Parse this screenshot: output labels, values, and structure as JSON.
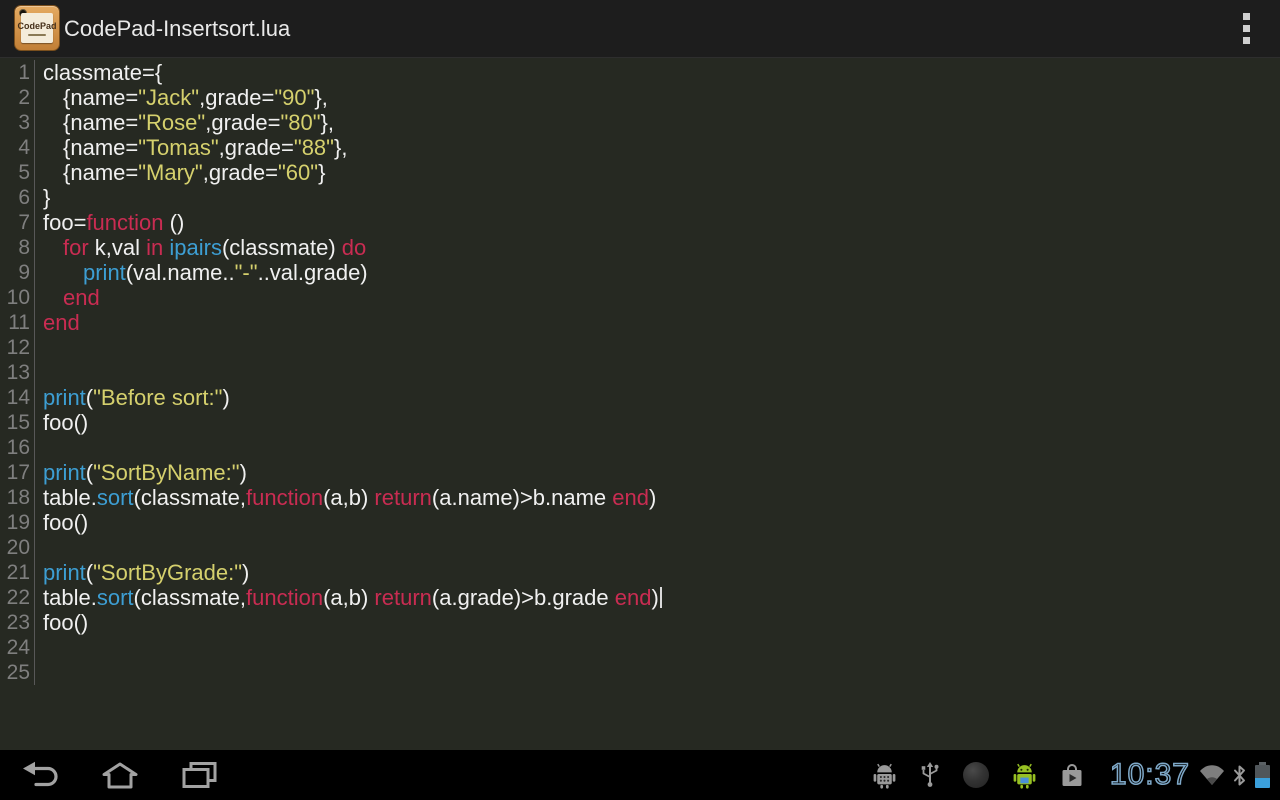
{
  "window": {
    "title": "CodePad-Insertsort.lua"
  },
  "titlebar": {
    "app_icon_label": "CodePad",
    "overflow_icon": "overflow-menu-icon"
  },
  "editor": {
    "colors": {
      "background": "#262922",
      "keyword": "#c92c52",
      "builtin": "#3d9ed3",
      "string": "#d5d06d",
      "text": "#f0f0f0",
      "line_number": "#7f7f7f"
    },
    "cursor": {
      "line": 22,
      "position": "end-of-line"
    },
    "lines": [
      {
        "n": "1",
        "segs": [
          [
            "classmate={",
            "p"
          ]
        ]
      },
      {
        "n": "2",
        "segs": [
          [
            "\t{name=",
            "p"
          ],
          [
            "\"Jack\"",
            "s"
          ],
          [
            ",grade=",
            "p"
          ],
          [
            "\"90\"",
            "s"
          ],
          [
            "},",
            "p"
          ]
        ]
      },
      {
        "n": "3",
        "segs": [
          [
            "\t{name=",
            "p"
          ],
          [
            "\"Rose\"",
            "s"
          ],
          [
            ",grade=",
            "p"
          ],
          [
            "\"80\"",
            "s"
          ],
          [
            "},",
            "p"
          ]
        ]
      },
      {
        "n": "4",
        "segs": [
          [
            "\t{name=",
            "p"
          ],
          [
            "\"Tomas\"",
            "s"
          ],
          [
            ",grade=",
            "p"
          ],
          [
            "\"88\"",
            "s"
          ],
          [
            "},",
            "p"
          ]
        ]
      },
      {
        "n": "5",
        "segs": [
          [
            "\t{name=",
            "p"
          ],
          [
            "\"Mary\"",
            "s"
          ],
          [
            ",grade=",
            "p"
          ],
          [
            "\"60\"",
            "s"
          ],
          [
            "}",
            "p"
          ]
        ]
      },
      {
        "n": "6",
        "segs": [
          [
            "}",
            "p"
          ]
        ]
      },
      {
        "n": "7",
        "segs": [
          [
            "foo=",
            "p"
          ],
          [
            "function",
            "k"
          ],
          [
            " ()",
            "p"
          ]
        ]
      },
      {
        "n": "8",
        "segs": [
          [
            "\t",
            "p"
          ],
          [
            "for",
            "k"
          ],
          [
            " k,val ",
            "p"
          ],
          [
            "in",
            "k"
          ],
          [
            " ",
            "p"
          ],
          [
            "ipairs",
            "f"
          ],
          [
            "(classmate) ",
            "p"
          ],
          [
            "do",
            "k"
          ]
        ]
      },
      {
        "n": "9",
        "segs": [
          [
            "\t\t",
            "p"
          ],
          [
            "print",
            "f"
          ],
          [
            "(val.name..",
            "p"
          ],
          [
            "\"-\"",
            "s"
          ],
          [
            "..val.grade)",
            "p"
          ]
        ]
      },
      {
        "n": "10",
        "segs": [
          [
            "\t",
            "p"
          ],
          [
            "end",
            "k"
          ]
        ]
      },
      {
        "n": "11",
        "segs": [
          [
            "end",
            "k"
          ]
        ]
      },
      {
        "n": "12",
        "segs": []
      },
      {
        "n": "13",
        "segs": []
      },
      {
        "n": "14",
        "segs": [
          [
            "print",
            "f"
          ],
          [
            "(",
            "p"
          ],
          [
            "\"Before sort:\"",
            "s"
          ],
          [
            ")",
            "p"
          ]
        ]
      },
      {
        "n": "15",
        "segs": [
          [
            "foo()",
            "p"
          ]
        ]
      },
      {
        "n": "16",
        "segs": []
      },
      {
        "n": "17",
        "segs": [
          [
            "print",
            "f"
          ],
          [
            "(",
            "p"
          ],
          [
            "\"SortByName:\"",
            "s"
          ],
          [
            ")",
            "p"
          ]
        ]
      },
      {
        "n": "18",
        "segs": [
          [
            "table.",
            "p"
          ],
          [
            "sort",
            "f"
          ],
          [
            "(classmate,",
            "p"
          ],
          [
            "function",
            "k"
          ],
          [
            "(a,b) ",
            "p"
          ],
          [
            "return",
            "k"
          ],
          [
            "(a.name)>b.name ",
            "p"
          ],
          [
            "end",
            "k"
          ],
          [
            ")",
            "p"
          ]
        ]
      },
      {
        "n": "19",
        "segs": [
          [
            "foo()",
            "p"
          ]
        ]
      },
      {
        "n": "20",
        "segs": []
      },
      {
        "n": "21",
        "segs": [
          [
            "print",
            "f"
          ],
          [
            "(",
            "p"
          ],
          [
            "\"SortByGrade:\"",
            "s"
          ],
          [
            ")",
            "p"
          ]
        ]
      },
      {
        "n": "22",
        "cursor": true,
        "segs": [
          [
            "table.",
            "p"
          ],
          [
            "sort",
            "f"
          ],
          [
            "(classmate,",
            "p"
          ],
          [
            "function",
            "k"
          ],
          [
            "(a,b) ",
            "p"
          ],
          [
            "return",
            "k"
          ],
          [
            "(a.grade)>b.grade ",
            "p"
          ],
          [
            "end",
            "k"
          ],
          [
            ")",
            "p"
          ]
        ]
      },
      {
        "n": "23",
        "segs": [
          [
            "foo()",
            "p"
          ]
        ]
      },
      {
        "n": "24",
        "segs": []
      },
      {
        "n": "25",
        "segs": []
      }
    ]
  },
  "navbar": {
    "nav_icons": [
      "back-icon",
      "home-icon",
      "recents-icon"
    ],
    "notification_icons": [
      "usb-debugging-icon",
      "usb-connected-icon",
      "dark-circle-notification-icon",
      "android-app-icon",
      "play-store-icon"
    ],
    "clock": "10:37",
    "status_icons": [
      "wifi-icon",
      "bluetooth-icon",
      "battery-icon"
    ],
    "clock_color": "#7fa9c9",
    "battery_fill_color": "#3ba0dc"
  }
}
